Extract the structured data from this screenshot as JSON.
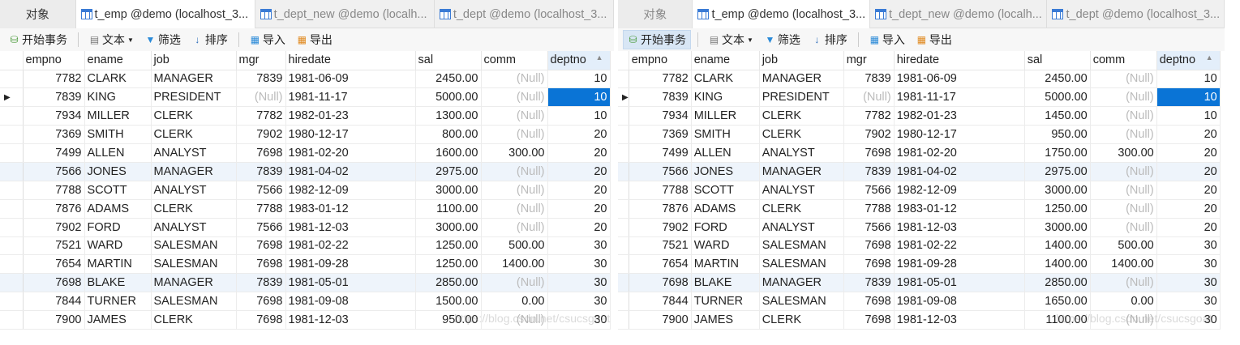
{
  "tabs": {
    "objects": "对象",
    "items": [
      "t_emp @demo (localhost_3...",
      "t_dept_new @demo (localh...",
      "t_dept @demo (localhost_3..."
    ]
  },
  "toolbar": {
    "begin_tx": "开始事务",
    "text": "文本",
    "filter": "筛选",
    "sort": "排序",
    "import": "导入",
    "export": "导出"
  },
  "columns": [
    "empno",
    "ename",
    "job",
    "mgr",
    "hiredate",
    "sal",
    "comm",
    "deptno"
  ],
  "sort_indicator": "▲",
  "row_marker": "▶",
  "null_text": "(Null)",
  "watermark": "https://blog.csdn.net/csucsgoat",
  "panels": [
    {
      "rows": [
        [
          "7782",
          "CLARK",
          "MANAGER",
          "7839",
          "1981-06-09",
          "2450.00",
          null,
          "10"
        ],
        [
          "7839",
          "KING",
          "PRESIDENT",
          null,
          "1981-11-17",
          "5000.00",
          null,
          "10"
        ],
        [
          "7934",
          "MILLER",
          "CLERK",
          "7782",
          "1982-01-23",
          "1300.00",
          null,
          "10"
        ],
        [
          "7369",
          "SMITH",
          "CLERK",
          "7902",
          "1980-12-17",
          "800.00",
          null,
          "20"
        ],
        [
          "7499",
          "ALLEN",
          "ANALYST",
          "7698",
          "1981-02-20",
          "1600.00",
          "300.00",
          "20"
        ],
        [
          "7566",
          "JONES",
          "MANAGER",
          "7839",
          "1981-04-02",
          "2975.00",
          null,
          "20"
        ],
        [
          "7788",
          "SCOTT",
          "ANALYST",
          "7566",
          "1982-12-09",
          "3000.00",
          null,
          "20"
        ],
        [
          "7876",
          "ADAMS",
          "CLERK",
          "7788",
          "1983-01-12",
          "1100.00",
          null,
          "20"
        ],
        [
          "7902",
          "FORD",
          "ANALYST",
          "7566",
          "1981-12-03",
          "3000.00",
          null,
          "20"
        ],
        [
          "7521",
          "WARD",
          "SALESMAN",
          "7698",
          "1981-02-22",
          "1250.00",
          "500.00",
          "30"
        ],
        [
          "7654",
          "MARTIN",
          "SALESMAN",
          "7698",
          "1981-09-28",
          "1250.00",
          "1400.00",
          "30"
        ],
        [
          "7698",
          "BLAKE",
          "MANAGER",
          "7839",
          "1981-05-01",
          "2850.00",
          null,
          "30"
        ],
        [
          "7844",
          "TURNER",
          "SALESMAN",
          "7698",
          "1981-09-08",
          "1500.00",
          "0.00",
          "30"
        ],
        [
          "7900",
          "JAMES",
          "CLERK",
          "7698",
          "1981-12-03",
          "950.00",
          null,
          "30"
        ]
      ]
    },
    {
      "rows": [
        [
          "7782",
          "CLARK",
          "MANAGER",
          "7839",
          "1981-06-09",
          "2450.00",
          null,
          "10"
        ],
        [
          "7839",
          "KING",
          "PRESIDENT",
          null,
          "1981-11-17",
          "5000.00",
          null,
          "10"
        ],
        [
          "7934",
          "MILLER",
          "CLERK",
          "7782",
          "1982-01-23",
          "1450.00",
          null,
          "10"
        ],
        [
          "7369",
          "SMITH",
          "CLERK",
          "7902",
          "1980-12-17",
          "950.00",
          null,
          "20"
        ],
        [
          "7499",
          "ALLEN",
          "ANALYST",
          "7698",
          "1981-02-20",
          "1750.00",
          "300.00",
          "20"
        ],
        [
          "7566",
          "JONES",
          "MANAGER",
          "7839",
          "1981-04-02",
          "2975.00",
          null,
          "20"
        ],
        [
          "7788",
          "SCOTT",
          "ANALYST",
          "7566",
          "1982-12-09",
          "3000.00",
          null,
          "20"
        ],
        [
          "7876",
          "ADAMS",
          "CLERK",
          "7788",
          "1983-01-12",
          "1250.00",
          null,
          "20"
        ],
        [
          "7902",
          "FORD",
          "ANALYST",
          "7566",
          "1981-12-03",
          "3000.00",
          null,
          "20"
        ],
        [
          "7521",
          "WARD",
          "SALESMAN",
          "7698",
          "1981-02-22",
          "1400.00",
          "500.00",
          "30"
        ],
        [
          "7654",
          "MARTIN",
          "SALESMAN",
          "7698",
          "1981-09-28",
          "1400.00",
          "1400.00",
          "30"
        ],
        [
          "7698",
          "BLAKE",
          "MANAGER",
          "7839",
          "1981-05-01",
          "2850.00",
          null,
          "30"
        ],
        [
          "7844",
          "TURNER",
          "SALESMAN",
          "7698",
          "1981-09-08",
          "1650.00",
          "0.00",
          "30"
        ],
        [
          "7900",
          "JAMES",
          "CLERK",
          "7698",
          "1981-12-03",
          "1100.00",
          null,
          "30"
        ]
      ]
    }
  ]
}
